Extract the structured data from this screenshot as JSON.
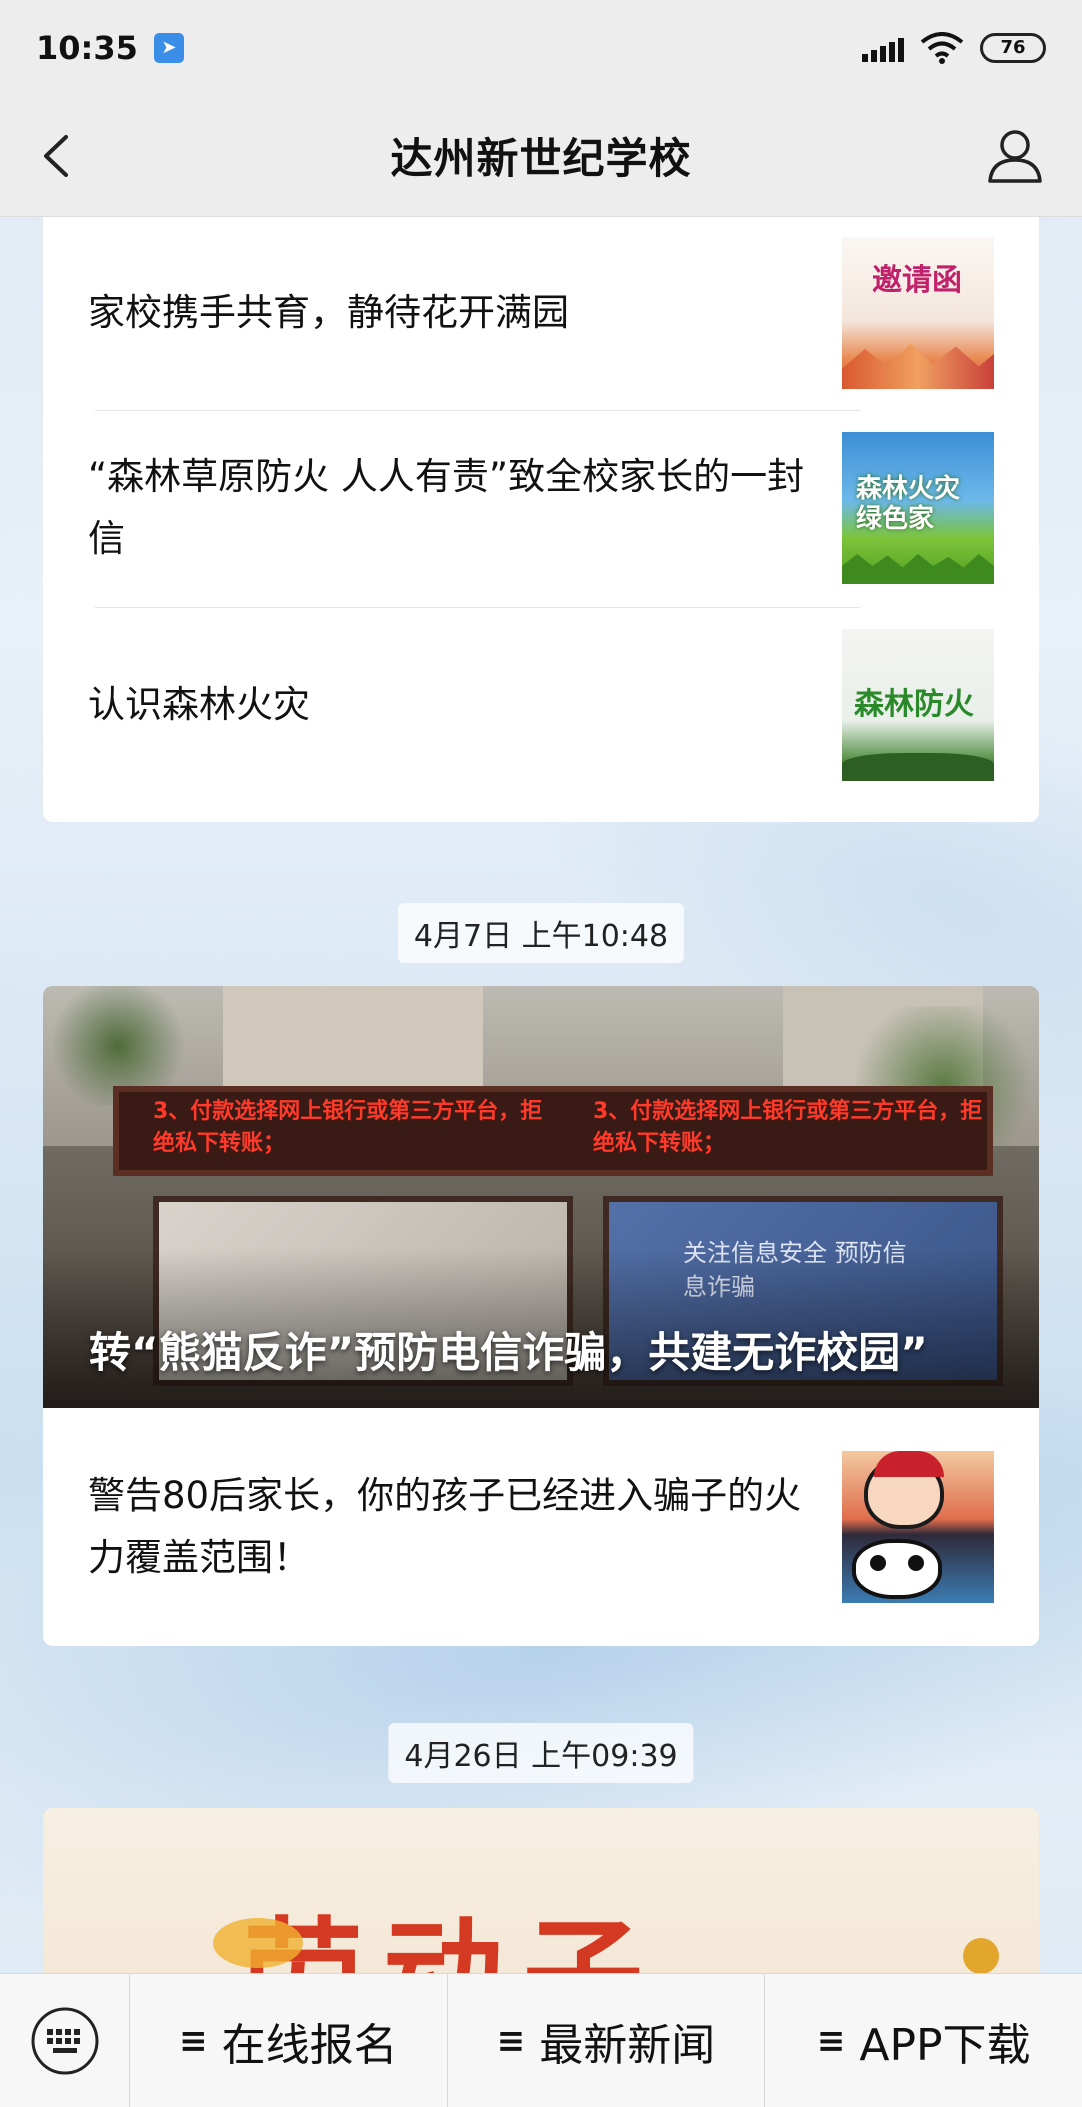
{
  "status_bar": {
    "time": "10:35",
    "battery": "76",
    "icons": [
      "app-notification-icon",
      "signal-icon",
      "wifi-icon",
      "battery-icon"
    ]
  },
  "nav": {
    "title": "达州新世纪学校",
    "back_icon": "chevron-left-icon",
    "user_icon": "user-icon"
  },
  "group1": {
    "articles": [
      {
        "title": "家校携手共育，静待花开满园",
        "thumb_text": "邀请函"
      },
      {
        "title": "“森林草原防火 人人有责”致全校家长的一封信",
        "thumb_text": "森林火灾 绿色家"
      },
      {
        "title": "认识森林火灾",
        "thumb_text": "森林防火"
      }
    ]
  },
  "group2": {
    "timestamp": "4月7日 上午10:48",
    "hero_title": "转“熊猫反诈”预防电信诈骗，共建无诈校园”",
    "hero_sign_text": "3、付款选择网上银行或第三方平台，拒绝私下转账；",
    "hero_board_text": "关注信息安全 预防信息诈骗",
    "articles": [
      {
        "title": "警告80后家长，你的孩子已经进入骗子的火力覆盖范围！"
      }
    ]
  },
  "group3": {
    "timestamp": "4月26日 上午09:39",
    "partial_image_text": "劳动子"
  },
  "bottom_menu": {
    "keyboard_icon": "keyboard-icon",
    "items": [
      {
        "label": "在线报名",
        "icon": "≡"
      },
      {
        "label": "最新新闻",
        "icon": "≡"
      },
      {
        "label": "APP下载",
        "icon": "≡"
      }
    ]
  },
  "colors": {
    "nav_bg": "#ededed",
    "card_bg": "#ffffff",
    "text": "#111111",
    "page_bg": "#dfe9f3"
  }
}
